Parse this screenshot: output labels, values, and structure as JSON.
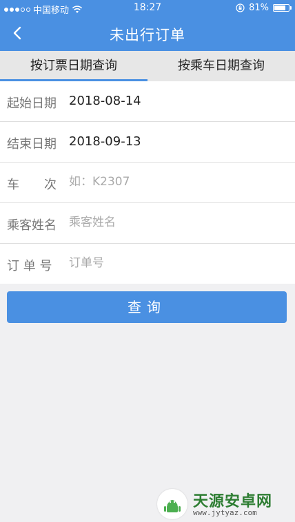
{
  "status_bar": {
    "carrier": "中国移动",
    "time": "18:27",
    "battery": "81%",
    "battery_level": 0.81
  },
  "nav": {
    "title": "未出行订单"
  },
  "tabs": [
    {
      "label": "按订票日期查询",
      "active": true
    },
    {
      "label": "按乘车日期查询",
      "active": false
    }
  ],
  "form": {
    "start_date": {
      "label": "起始日期",
      "value": "2018-08-14"
    },
    "end_date": {
      "label": "结束日期",
      "value": "2018-09-13"
    },
    "train_no": {
      "label": "车　　次",
      "placeholder": "如：K2307"
    },
    "passenger": {
      "label": "乘客姓名",
      "placeholder": "乘客姓名"
    },
    "order_no": {
      "label": "订 单 号",
      "placeholder": "订单号"
    }
  },
  "query_button": "查询",
  "watermark": {
    "name": "天源安卓网",
    "url": "www.jytyaz.com"
  },
  "colors": {
    "primary": "#4a90e2",
    "background": "#f0f0f2"
  }
}
